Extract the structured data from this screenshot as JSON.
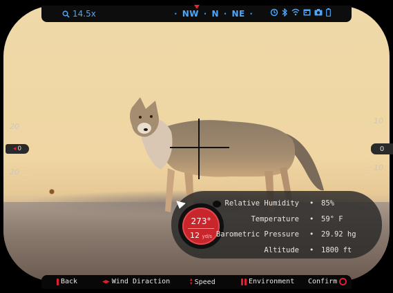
{
  "header": {
    "zoom": "14.5x",
    "compass": [
      "NW",
      "N",
      "NE"
    ],
    "icons": [
      "timer-icon",
      "bluetooth-icon",
      "wifi-icon",
      "calendar-icon",
      "camera-icon",
      "battery-icon"
    ],
    "accent_color": "#4aa8ff"
  },
  "scales": {
    "left_top": "20",
    "left_bottom": "20",
    "left_indicator": "0",
    "right_top": "10",
    "right_bottom": "10",
    "right_indicator": "0"
  },
  "wind_dial": {
    "direction": "273°",
    "speed": "12",
    "speed_unit": "yd/s",
    "color": "#c8262a"
  },
  "environment": [
    {
      "label": "Relative Humidity",
      "value": "85%"
    },
    {
      "label": "Temperature",
      "value": "59° F"
    },
    {
      "label": "Barometric Pressure",
      "value": "29.92 hg"
    },
    {
      "label": "Altitude",
      "value": "1800 ft"
    }
  ],
  "footer": {
    "back": "Back",
    "wind_direction": "Wind Diraction",
    "speed": "Speed",
    "environment": "Environment",
    "confirm": "Confirm"
  }
}
